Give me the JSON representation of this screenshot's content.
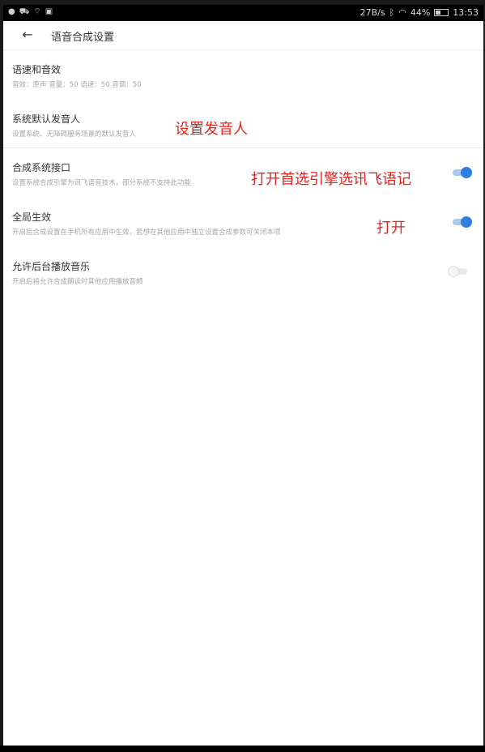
{
  "status_bar": {
    "speed": "27B/s",
    "battery": "44%",
    "battery_level": 0.44,
    "time": "13:53"
  },
  "header": {
    "title": "语音合成设置"
  },
  "items": [
    {
      "title": "语速和音效",
      "subtitle": "音效：原声 音量：50 语速：50 音调：50"
    },
    {
      "title": "系统默认发音人",
      "subtitle": "设置系统、无障碍服务场景的默认发音人"
    },
    {
      "title": "合成系统接口",
      "subtitle": "设置系统合成引擎为讯飞语音技术，部分系统不支持此功能",
      "toggle": true
    },
    {
      "title": "全局生效",
      "subtitle": "开启后合成设置在手机所有应用中生效，若想在其他应用中独立设置合成参数可关闭本项",
      "toggle": true
    },
    {
      "title": "允许后台播放音乐",
      "subtitle": "开启后将允许合成朗读时其他应用播放音频",
      "toggle": false
    }
  ],
  "annotations": {
    "set_speaker": "设置发音人",
    "open_engine": "打开首选引擎选讯飞语记",
    "open": "打开"
  },
  "colors": {
    "accent": "#2f7fe0",
    "annotation": "#e3231f"
  }
}
